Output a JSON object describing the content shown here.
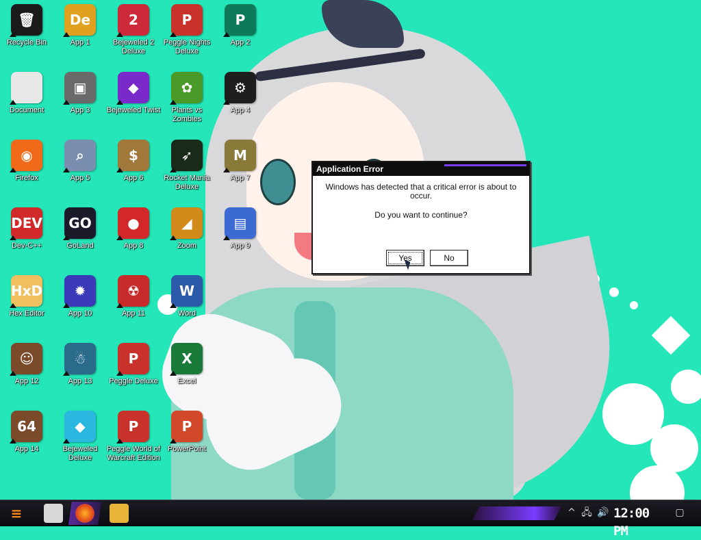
{
  "desktop": {
    "icons": [
      {
        "label": "Recycle Bin",
        "glyph": "🗑",
        "color": "#1b1b1b"
      },
      {
        "label": "App 1",
        "glyph": "De",
        "color": "#e0a020"
      },
      {
        "label": "Bejeweled 2 Deluxe",
        "glyph": "2",
        "color": "#cc2a3a"
      },
      {
        "label": "Peggle Nights Deluxe",
        "glyph": "P",
        "color": "#c8322a"
      },
      {
        "label": "App 2",
        "glyph": "P",
        "color": "#0d7a5a"
      },
      {
        "label": "Document",
        "glyph": "",
        "color": "#e8e8e8"
      },
      {
        "label": "App 3",
        "glyph": "▣",
        "color": "#6a6a6a"
      },
      {
        "label": "Bejeweled Twist",
        "glyph": "◆",
        "color": "#7a2ac8"
      },
      {
        "label": "Plants vs Zombies",
        "glyph": "✿",
        "color": "#4a9a2a"
      },
      {
        "label": "App 4",
        "glyph": "⚙",
        "color": "#1e1e1e"
      },
      {
        "label": "Firefox",
        "glyph": "◉",
        "color": "#f06a1a"
      },
      {
        "label": "App 5",
        "glyph": "⌕",
        "color": "#7a8fb0"
      },
      {
        "label": "App 6",
        "glyph": "$",
        "color": "#a0783a"
      },
      {
        "label": "Rocket Mania Deluxe",
        "glyph": "➶",
        "color": "#1a2a1a"
      },
      {
        "label": "App 7",
        "glyph": "M",
        "color": "#8a7a3a"
      },
      {
        "label": "Dev-C++",
        "glyph": "DEV",
        "color": "#d22a2a"
      },
      {
        "label": "GoLand",
        "glyph": "GO",
        "color": "#1a1a2a"
      },
      {
        "label": "App 8",
        "glyph": "●",
        "color": "#d2282a"
      },
      {
        "label": "Zoom",
        "glyph": "◢",
        "color": "#d28a1a"
      },
      {
        "label": "App 9",
        "glyph": "▤",
        "color": "#3a6ad2"
      },
      {
        "label": "Hex Editor",
        "glyph": "HxD",
        "color": "#f0c060"
      },
      {
        "label": "App 10",
        "glyph": "✹",
        "color": "#3a3ab8"
      },
      {
        "label": "App 11",
        "glyph": "☢",
        "color": "#c82a2a"
      },
      {
        "label": "Word",
        "glyph": "W",
        "color": "#2a5aa8"
      },
      {
        "label": "App 12",
        "glyph": "☺",
        "color": "#7a4a2a"
      },
      {
        "label": "App 13",
        "glyph": "☃",
        "color": "#2a6a8a"
      },
      {
        "label": "Peggle Deluxe",
        "glyph": "P",
        "color": "#c8322a"
      },
      {
        "label": "Excel",
        "glyph": "X",
        "color": "#1a7a3a"
      },
      {
        "label": "App 14",
        "glyph": "64",
        "color": "#7a4a2a"
      },
      {
        "label": "Bejeweled Deluxe",
        "glyph": "◆",
        "color": "#2ab8e0"
      },
      {
        "label": "Peggle World of Warcraft Edition",
        "glyph": "P",
        "color": "#c8322a"
      },
      {
        "label": "PowerPoint",
        "glyph": "P",
        "color": "#d2482a"
      }
    ]
  },
  "dialog": {
    "title": "Application Error",
    "message": "Windows has detected that a critical error is about to occur.",
    "question": "Do you want to continue?",
    "yes_label": "Yes",
    "no_label": "No"
  },
  "taskbar": {
    "start_glyph": "≡",
    "clock": "12:00 PM",
    "tray_chevron": "^",
    "tray_network": "🖧",
    "tray_volume": "🔊",
    "notification_glyph": "▢"
  },
  "colors": {
    "desktop_background": "#24e6b8",
    "taskbar_accent": "#7a3cff"
  }
}
